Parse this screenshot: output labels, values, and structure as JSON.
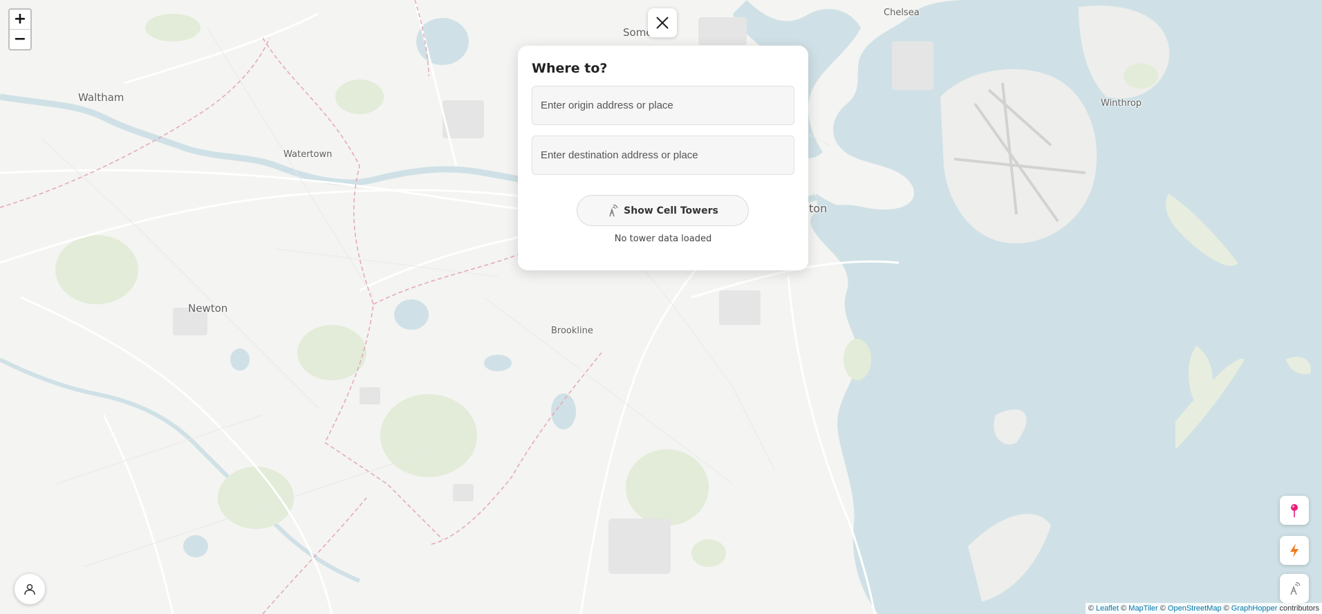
{
  "map": {
    "labels": {
      "chelsea": "Chelsea",
      "somerville": "Some",
      "waltham": "Waltham",
      "watertown": "Watertown",
      "winthrop": "Winthrop",
      "boston": "ton",
      "newton": "Newton",
      "brookline": "Brookline"
    },
    "colors": {
      "land": "#f4f4f2",
      "water": "#cfe1e6",
      "park": "#e2ecd8",
      "road": "#ffffff",
      "boundary": "#e4a6b6"
    }
  },
  "zoom": {
    "in_label": "+",
    "out_label": "−"
  },
  "panel": {
    "title": "Where to?",
    "origin_placeholder": "Enter origin address or place",
    "destination_placeholder": "Enter destination address or place",
    "tower_button_label": "Show Cell Towers",
    "tower_status": "No tower data loaded"
  },
  "icons": {
    "close": "close-icon",
    "tower": "cell-tower-icon",
    "pin": "map-pin-icon",
    "bolt": "lightning-icon",
    "profile": "user-icon"
  },
  "accent_colors": {
    "pin": "#e91e7a",
    "bolt": "#f07a1a"
  },
  "attribution": {
    "copy1": "©",
    "leaflet": "Leaflet",
    "copy2": "©",
    "maptiler": "MapTiler",
    "copy3": "©",
    "osm": "OpenStreetMap",
    "copy4": "©",
    "graphhopper": "GraphHopper",
    "suffix": "contributors"
  }
}
